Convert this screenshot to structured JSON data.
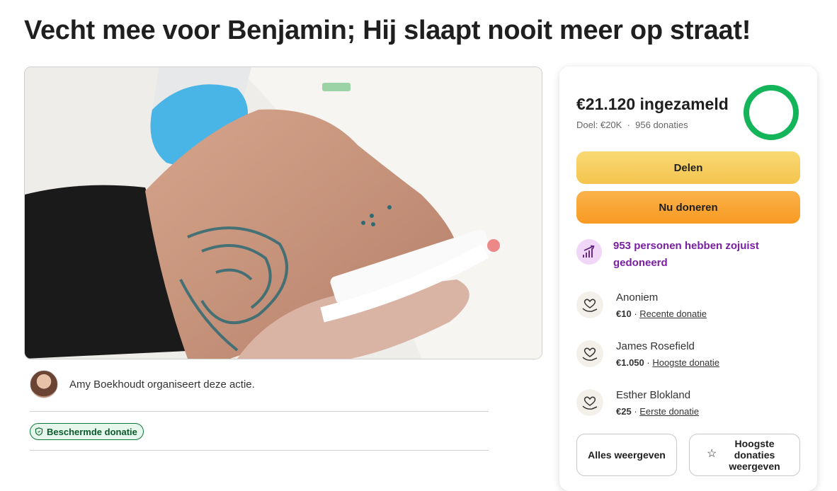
{
  "page": {
    "title": "Vecht mee voor Benjamin; Hij slaapt nooit meer op straat!"
  },
  "organizer": {
    "text": "Amy Boekhoudt organiseert deze actie."
  },
  "badge": {
    "label": "Beschermde donatie"
  },
  "donation_card": {
    "raised": "€21.120 ingezameld",
    "goal": "Doel: €20K",
    "separator": "·",
    "donations": "956 donaties",
    "progress": 1.0,
    "progress_color": "#14b45a",
    "share_label": "Delen",
    "donate_label": "Nu doneren",
    "trend_text": "953 personen hebben zojuist gedoneerd",
    "donors": [
      {
        "name": "Anoniem",
        "amount": "€10",
        "sep": " · ",
        "tag": "Recente donatie"
      },
      {
        "name": "James Rosefield",
        "amount": "€1.050",
        "sep": " · ",
        "tag": "Hoogste donatie"
      },
      {
        "name": "Esther Blokland",
        "amount": "€25",
        "sep": " · ",
        "tag": "Eerste donatie"
      }
    ],
    "show_all_label": "Alles weergeven",
    "top_donations_label": "Hoogste donaties weergeven"
  },
  "icons": {
    "badge": "shield-icon",
    "trend": "trend-up-icon",
    "donor": "heart-hand-icon",
    "top": "star-icon"
  }
}
